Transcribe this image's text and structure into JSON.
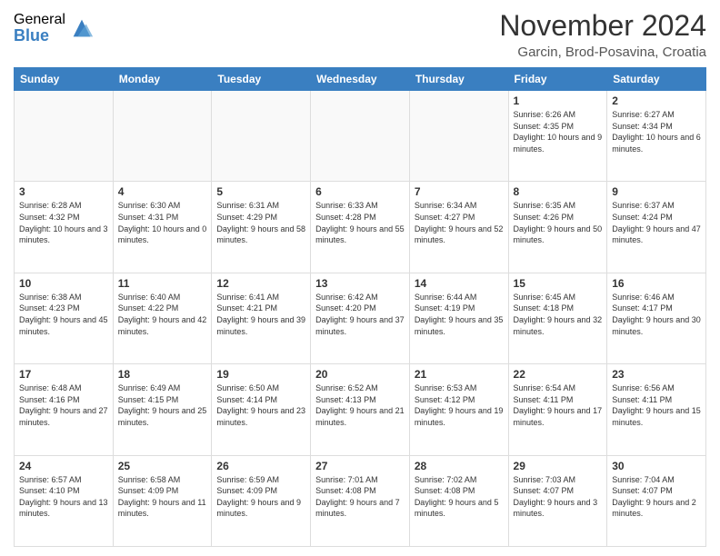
{
  "header": {
    "logo_general": "General",
    "logo_blue": "Blue",
    "month_title": "November 2024",
    "location": "Garcin, Brod-Posavina, Croatia"
  },
  "days_of_week": [
    "Sunday",
    "Monday",
    "Tuesday",
    "Wednesday",
    "Thursday",
    "Friday",
    "Saturday"
  ],
  "weeks": [
    [
      {
        "day": "",
        "info": ""
      },
      {
        "day": "",
        "info": ""
      },
      {
        "day": "",
        "info": ""
      },
      {
        "day": "",
        "info": ""
      },
      {
        "day": "",
        "info": ""
      },
      {
        "day": "1",
        "info": "Sunrise: 6:26 AM\nSunset: 4:35 PM\nDaylight: 10 hours and 9 minutes."
      },
      {
        "day": "2",
        "info": "Sunrise: 6:27 AM\nSunset: 4:34 PM\nDaylight: 10 hours and 6 minutes."
      }
    ],
    [
      {
        "day": "3",
        "info": "Sunrise: 6:28 AM\nSunset: 4:32 PM\nDaylight: 10 hours and 3 minutes."
      },
      {
        "day": "4",
        "info": "Sunrise: 6:30 AM\nSunset: 4:31 PM\nDaylight: 10 hours and 0 minutes."
      },
      {
        "day": "5",
        "info": "Sunrise: 6:31 AM\nSunset: 4:29 PM\nDaylight: 9 hours and 58 minutes."
      },
      {
        "day": "6",
        "info": "Sunrise: 6:33 AM\nSunset: 4:28 PM\nDaylight: 9 hours and 55 minutes."
      },
      {
        "day": "7",
        "info": "Sunrise: 6:34 AM\nSunset: 4:27 PM\nDaylight: 9 hours and 52 minutes."
      },
      {
        "day": "8",
        "info": "Sunrise: 6:35 AM\nSunset: 4:26 PM\nDaylight: 9 hours and 50 minutes."
      },
      {
        "day": "9",
        "info": "Sunrise: 6:37 AM\nSunset: 4:24 PM\nDaylight: 9 hours and 47 minutes."
      }
    ],
    [
      {
        "day": "10",
        "info": "Sunrise: 6:38 AM\nSunset: 4:23 PM\nDaylight: 9 hours and 45 minutes."
      },
      {
        "day": "11",
        "info": "Sunrise: 6:40 AM\nSunset: 4:22 PM\nDaylight: 9 hours and 42 minutes."
      },
      {
        "day": "12",
        "info": "Sunrise: 6:41 AM\nSunset: 4:21 PM\nDaylight: 9 hours and 39 minutes."
      },
      {
        "day": "13",
        "info": "Sunrise: 6:42 AM\nSunset: 4:20 PM\nDaylight: 9 hours and 37 minutes."
      },
      {
        "day": "14",
        "info": "Sunrise: 6:44 AM\nSunset: 4:19 PM\nDaylight: 9 hours and 35 minutes."
      },
      {
        "day": "15",
        "info": "Sunrise: 6:45 AM\nSunset: 4:18 PM\nDaylight: 9 hours and 32 minutes."
      },
      {
        "day": "16",
        "info": "Sunrise: 6:46 AM\nSunset: 4:17 PM\nDaylight: 9 hours and 30 minutes."
      }
    ],
    [
      {
        "day": "17",
        "info": "Sunrise: 6:48 AM\nSunset: 4:16 PM\nDaylight: 9 hours and 27 minutes."
      },
      {
        "day": "18",
        "info": "Sunrise: 6:49 AM\nSunset: 4:15 PM\nDaylight: 9 hours and 25 minutes."
      },
      {
        "day": "19",
        "info": "Sunrise: 6:50 AM\nSunset: 4:14 PM\nDaylight: 9 hours and 23 minutes."
      },
      {
        "day": "20",
        "info": "Sunrise: 6:52 AM\nSunset: 4:13 PM\nDaylight: 9 hours and 21 minutes."
      },
      {
        "day": "21",
        "info": "Sunrise: 6:53 AM\nSunset: 4:12 PM\nDaylight: 9 hours and 19 minutes."
      },
      {
        "day": "22",
        "info": "Sunrise: 6:54 AM\nSunset: 4:11 PM\nDaylight: 9 hours and 17 minutes."
      },
      {
        "day": "23",
        "info": "Sunrise: 6:56 AM\nSunset: 4:11 PM\nDaylight: 9 hours and 15 minutes."
      }
    ],
    [
      {
        "day": "24",
        "info": "Sunrise: 6:57 AM\nSunset: 4:10 PM\nDaylight: 9 hours and 13 minutes."
      },
      {
        "day": "25",
        "info": "Sunrise: 6:58 AM\nSunset: 4:09 PM\nDaylight: 9 hours and 11 minutes."
      },
      {
        "day": "26",
        "info": "Sunrise: 6:59 AM\nSunset: 4:09 PM\nDaylight: 9 hours and 9 minutes."
      },
      {
        "day": "27",
        "info": "Sunrise: 7:01 AM\nSunset: 4:08 PM\nDaylight: 9 hours and 7 minutes."
      },
      {
        "day": "28",
        "info": "Sunrise: 7:02 AM\nSunset: 4:08 PM\nDaylight: 9 hours and 5 minutes."
      },
      {
        "day": "29",
        "info": "Sunrise: 7:03 AM\nSunset: 4:07 PM\nDaylight: 9 hours and 3 minutes."
      },
      {
        "day": "30",
        "info": "Sunrise: 7:04 AM\nSunset: 4:07 PM\nDaylight: 9 hours and 2 minutes."
      }
    ]
  ]
}
